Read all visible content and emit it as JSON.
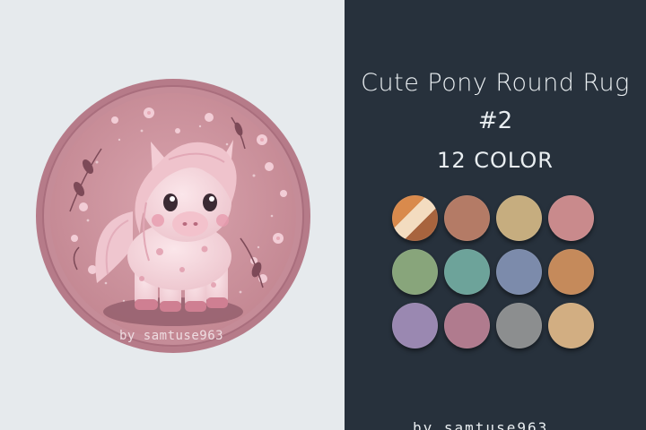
{
  "product": {
    "title_line1": "Cute Pony Round Rug",
    "title_line2": "#2",
    "title_line3": "12 COLOR",
    "watermark": "by samtuse963",
    "footer_peek": "by samtuse963"
  },
  "rug": {
    "base_color": "#c98e9a",
    "border_color": "#b57887",
    "pony_color": "#f6d5dc",
    "mane_color": "#eec3cd",
    "accent_color": "#7b4c5a"
  },
  "swatches": [
    {
      "name": "multi-orange-cream-brown",
      "colors": [
        "#d98a4c",
        "#f3dcc0",
        "#a8643e"
      ]
    },
    {
      "name": "terracotta-brown",
      "colors": [
        "#b47b66"
      ]
    },
    {
      "name": "sand-beige",
      "colors": [
        "#c6ad7f"
      ]
    },
    {
      "name": "dusty-rose",
      "colors": [
        "#c98a8c"
      ]
    },
    {
      "name": "sage-green",
      "colors": [
        "#88a57b"
      ]
    },
    {
      "name": "teal-green",
      "colors": [
        "#6da39a"
      ]
    },
    {
      "name": "slate-blue",
      "colors": [
        "#7c8bab"
      ]
    },
    {
      "name": "caramel",
      "colors": [
        "#c58a5b"
      ]
    },
    {
      "name": "lavender",
      "colors": [
        "#9a88b1"
      ]
    },
    {
      "name": "mauve",
      "colors": [
        "#b07b8e"
      ]
    },
    {
      "name": "grey",
      "colors": [
        "#8c8e8f"
      ]
    },
    {
      "name": "wheat",
      "colors": [
        "#d2ae82"
      ]
    }
  ]
}
